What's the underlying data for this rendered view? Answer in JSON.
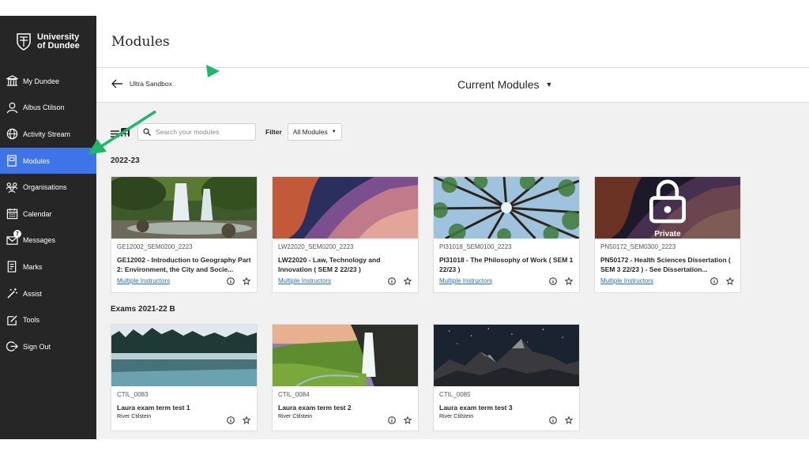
{
  "brand": {
    "line1": "University",
    "line2": "of Dundee"
  },
  "sidebar": {
    "items": [
      {
        "label": "My Dundee",
        "icon": "institution-icon"
      },
      {
        "label": "Albus Ctilson",
        "icon": "user-icon"
      },
      {
        "label": "Activity Stream",
        "icon": "globe-icon"
      },
      {
        "label": "Modules",
        "icon": "book-icon",
        "active": true
      },
      {
        "label": "Organisations",
        "icon": "group-icon"
      },
      {
        "label": "Calendar",
        "icon": "calendar-icon"
      },
      {
        "label": "Messages",
        "icon": "envelope-icon",
        "badge": "7"
      },
      {
        "label": "Marks",
        "icon": "grades-icon"
      },
      {
        "label": "Assist",
        "icon": "wand-icon"
      },
      {
        "label": "Tools",
        "icon": "tools-icon"
      },
      {
        "label": "Sign Out",
        "icon": "sign-out-icon"
      }
    ]
  },
  "page": {
    "title": "Modules"
  },
  "subbar": {
    "back_label": "Ultra Sandbox",
    "current": "Current Modules"
  },
  "toolbar": {
    "search_placeholder": "Search your modules",
    "filter_label": "Filter",
    "filter_value": "All Modules"
  },
  "sections": [
    {
      "title": "2022-23",
      "cards": [
        {
          "code": "GE12002_SEM0200_2223",
          "name": "GE12002 - Introduction to Geography Part 2: Environment, the City and Socie...",
          "instructors": "Multiple Instructors",
          "image": "waterfall-forest"
        },
        {
          "code": "LW22020_SEM0200_2223",
          "name": "LW22020 - Law, Technology and Innovation ( SEM 2 22/23 )",
          "instructors": "Multiple Instructors",
          "image": "canyon"
        },
        {
          "code": "PI31018_SEM0100_2223",
          "name": "PI31018 - The Philosophy of Work ( SEM 1 22/23 )",
          "instructors": "Multiple Instructors",
          "image": "tree-canopy"
        },
        {
          "code": "PN50172_SEM0300_2223",
          "name": "PN50172 - Health Sciences Dissertation ( SEM 3 22/23 ) - See Dissertation...",
          "instructors": "Multiple Instructors",
          "image": "canyon",
          "private_label": "Private"
        }
      ]
    },
    {
      "title": "Exams 2021-22 B",
      "cards": [
        {
          "code": "CTIL_0083",
          "name": "Laura exam term test 1",
          "person": "River Ctilstein",
          "image": "misty-lake"
        },
        {
          "code": "CTIL_0084",
          "name": "Laura exam term test 2",
          "person": "River Ctilstein",
          "image": "waterfall-meadow"
        },
        {
          "code": "CTIL_0085",
          "name": "Laura exam term test 3",
          "person": "River Ctilstein",
          "image": "night-mountain"
        }
      ]
    }
  ],
  "colors": {
    "sidebar": "#262626",
    "active": "#3f73e8",
    "link": "#2a6fb7",
    "annotation_arrow": "#1fb86a"
  }
}
